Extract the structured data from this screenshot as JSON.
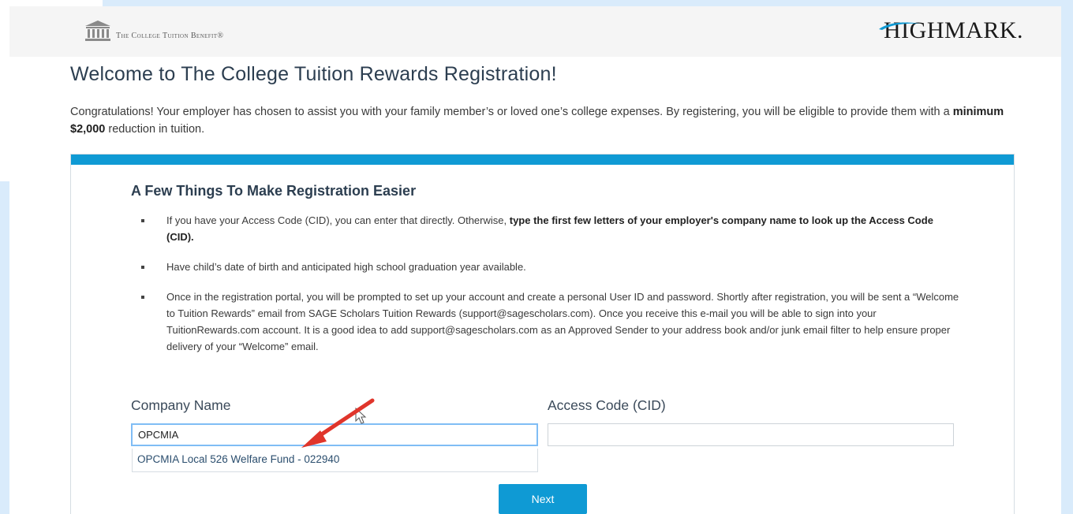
{
  "header": {
    "left_brand": "The College Tuition Benefit®",
    "right_brand": "HIGHMARK."
  },
  "page": {
    "title": "Welcome to The College Tuition Rewards Registration!",
    "intro_part1": "Congratulations! Your employer has chosen to assist you with your family member’s or loved one’s college expenses. By registering, you will be eligible to provide them with a ",
    "intro_bold": "minimum $2,000",
    "intro_part2": " reduction in tuition."
  },
  "panel": {
    "heading": "A Few Things To Make Registration Easier",
    "tips": [
      {
        "text": "If you have your Access Code (CID), you can enter that directly. Otherwise, ",
        "bold": "type the first few letters of your employer's company name to look up the Access Code (CID)."
      },
      {
        "text": "Have child’s date of birth and anticipated high school graduation year available.",
        "bold": ""
      },
      {
        "text": "Once in the registration portal, you will be prompted to set up your account and create a personal User ID and password. Shortly after registration, you will be sent a “Welcome to Tuition Rewards” email from SAGE Scholars Tuition Rewards (support@sagescholars.com). Once you receive this e-mail you will be able to sign into your TuitionRewards.com account. It is a good idea to add support@sagescholars.com as an Approved Sender to your address book and/or junk email filter to help ensure proper delivery of your “Welcome” email.",
        "bold": ""
      }
    ]
  },
  "form": {
    "company_label": "Company Name",
    "company_value": "OPCMIA",
    "access_label": "Access Code (CID)",
    "access_value": "",
    "suggestion": "OPCMIA Local 526 Welfare Fund - 022940",
    "next_label": "Next"
  },
  "colors": {
    "accent": "#0f9ad4",
    "arrow": "#e0352b",
    "side_strip": "#d9ebfb"
  }
}
